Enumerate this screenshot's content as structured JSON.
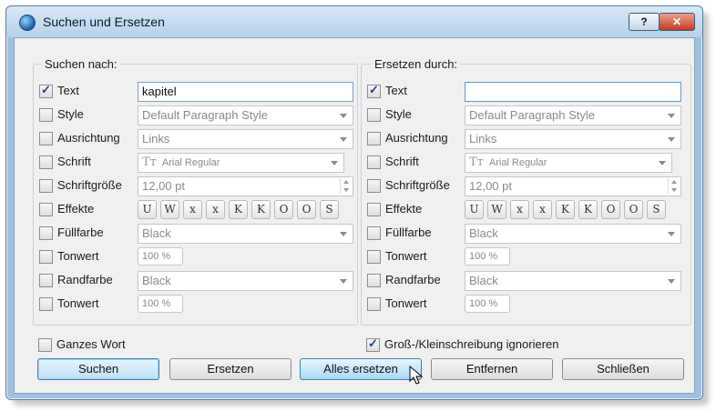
{
  "window": {
    "title": "Suchen und Ersetzen",
    "help_label": "?",
    "close_label": "✕"
  },
  "search": {
    "legend": "Suchen nach:",
    "rows": [
      {
        "label": "Text",
        "checked": true,
        "value": "kapitel"
      },
      {
        "label": "Style",
        "checked": false,
        "value": "Default Paragraph Style"
      },
      {
        "label": "Ausrichtung",
        "checked": false,
        "value": "Links"
      },
      {
        "label": "Schrift",
        "checked": false,
        "value": "Arial Regular"
      },
      {
        "label": "Schriftgröße",
        "checked": false,
        "value": "12,00 pt"
      },
      {
        "label": "Effekte",
        "checked": false
      },
      {
        "label": "Füllfarbe",
        "checked": false,
        "value": "Black"
      },
      {
        "label": "Tonwert",
        "checked": false,
        "value": "100 %"
      },
      {
        "label": "Randfarbe",
        "checked": false,
        "value": "Black"
      },
      {
        "label": "Tonwert",
        "checked": false,
        "value": "100 %"
      }
    ]
  },
  "replace": {
    "legend": "Ersetzen durch:",
    "rows": [
      {
        "label": "Text",
        "checked": true,
        "value": ""
      },
      {
        "label": "Style",
        "checked": false,
        "value": "Default Paragraph Style"
      },
      {
        "label": "Ausrichtung",
        "checked": false,
        "value": "Links"
      },
      {
        "label": "Schrift",
        "checked": false,
        "value": "Arial Regular"
      },
      {
        "label": "Schriftgröße",
        "checked": false,
        "value": "12,00 pt"
      },
      {
        "label": "Effekte",
        "checked": false
      },
      {
        "label": "Füllfarbe",
        "checked": false,
        "value": "Black"
      },
      {
        "label": "Tonwert",
        "checked": false,
        "value": "100 %"
      },
      {
        "label": "Randfarbe",
        "checked": false,
        "value": "Black"
      },
      {
        "label": "Tonwert",
        "checked": false,
        "value": "100 %"
      }
    ]
  },
  "effects": [
    "U",
    "W",
    "x",
    "x",
    "K",
    "K",
    "O",
    "O",
    "S"
  ],
  "font_icon": "Tт",
  "options": {
    "whole_word": "Ganzes Wort",
    "whole_word_checked": false,
    "ignore_case": "Groß-/Kleinschreibung ignorieren",
    "ignore_case_checked": true
  },
  "buttons": {
    "search": "Suchen",
    "replace": "Ersetzen",
    "replace_all": "Alles ersetzen",
    "remove": "Entfernen",
    "close": "Schließen"
  },
  "colors": {
    "titlebar": "#b7d1ea",
    "default_button": "#bfe0f5",
    "close_button": "#c43c21"
  }
}
